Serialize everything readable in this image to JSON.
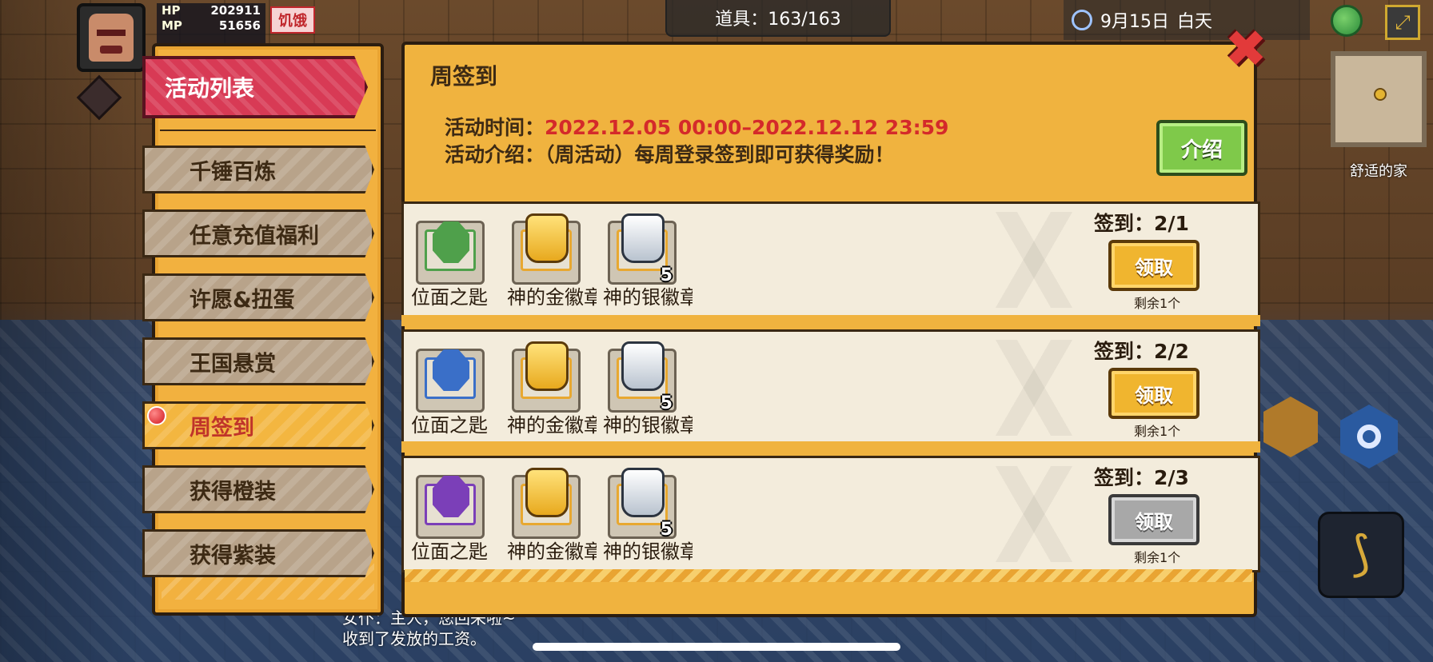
{
  "hud": {
    "hp_label": "HP",
    "hp_value": "202911",
    "mp_label": "MP",
    "mp_value": "51656",
    "status_badge": "饥饿",
    "items_counter": "道具：163/163",
    "date": "9月15日",
    "time_of_day": "白天",
    "location": "舒适的家"
  },
  "sidebar": {
    "header": "活动列表",
    "items": [
      {
        "label": "千锤百炼"
      },
      {
        "label": "任意充值福利"
      },
      {
        "label": "许愿&扭蛋"
      },
      {
        "label": "王国悬赏"
      },
      {
        "label": "周签到",
        "active": true
      },
      {
        "label": "获得橙装"
      },
      {
        "label": "获得紫装"
      }
    ]
  },
  "panel": {
    "title": "周签到",
    "time_label": "活动时间：",
    "time_value": "2022.12.05 00:00–2022.12.12 23:59",
    "intro_label": "活动介绍：",
    "intro_value": "（周活动）每周登录签到即可获得奖励！",
    "intro_button": "介绍",
    "rewards": [
      {
        "signin_label": "签到：2/1",
        "claim_label": "领取",
        "claim_enabled": true,
        "remaining": "剩余1个",
        "items": [
          {
            "name": "位面之匙",
            "icon": "green-plane-key-icon",
            "color": "#4fa04b"
          },
          {
            "name": "神的金徽章",
            "icon": "gold-badge-icon"
          },
          {
            "name": "神的银徽章",
            "icon": "silver-badge-icon",
            "quantity": "5"
          }
        ]
      },
      {
        "signin_label": "签到：2/2",
        "claim_label": "领取",
        "claim_enabled": true,
        "remaining": "剩余1个",
        "items": [
          {
            "name": "位面之匙",
            "icon": "blue-plane-key-icon",
            "color": "#3a6fc8"
          },
          {
            "name": "神的金徽章",
            "icon": "gold-badge-icon"
          },
          {
            "name": "神的银徽章",
            "icon": "silver-badge-icon",
            "quantity": "5"
          }
        ]
      },
      {
        "signin_label": "签到：2/3",
        "claim_label": "领取",
        "claim_enabled": false,
        "remaining": "剩余1个",
        "items": [
          {
            "name": "位面之匙",
            "icon": "purple-plane-key-icon",
            "color": "#7b3fb8"
          },
          {
            "name": "神的金徽章",
            "icon": "gold-badge-icon"
          },
          {
            "name": "神的银徽章",
            "icon": "silver-badge-icon",
            "quantity": "5"
          }
        ]
      }
    ]
  },
  "chat": {
    "line1": "女仆：主人，您回来啦~",
    "line2": "收到了发放的工资。"
  },
  "colors": {
    "panel_gold": "#f0b33f",
    "header_red": "#d83a55",
    "time_red": "#d42a2a",
    "intro_green": "#7fc94a",
    "claim_gold": "#f0b52f",
    "claim_gray": "#a8a8a8"
  }
}
